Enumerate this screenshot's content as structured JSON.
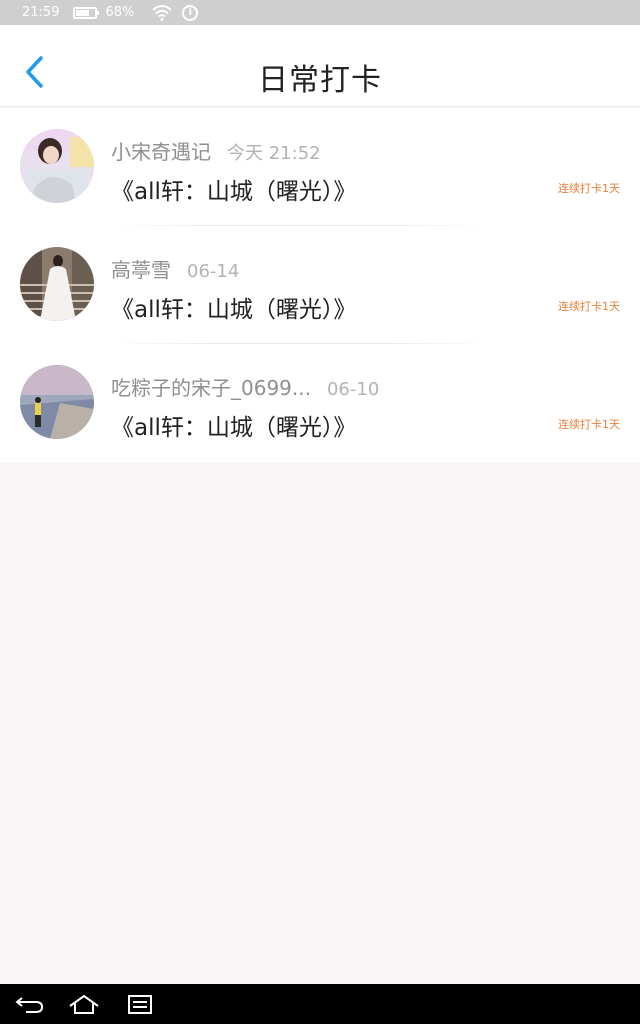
{
  "status_bar": {
    "time": "21:59",
    "battery_text": "68%",
    "battery_level": 0.68
  },
  "header": {
    "title": "日常打卡"
  },
  "items": [
    {
      "name": "小宋奇遇记",
      "date": "今天 21:52",
      "content": "《all轩：山城（曙光）》",
      "streak": "连续打卡1天"
    },
    {
      "name": "高葶雪",
      "date": "06-14",
      "content": "《all轩：山城（曙光）》",
      "streak": "连续打卡1天"
    },
    {
      "name": "吃粽子的宋子_0699...",
      "date": "06-10",
      "content": "《all轩：山城（曙光）》",
      "streak": "连续打卡1天"
    }
  ],
  "colors": {
    "accent": "#1e9be8",
    "streak": "#e8803a",
    "statusbar": "#cfcfcf",
    "background": "#f7f5f5"
  },
  "icons": {
    "back": "back-arrow-icon",
    "nav_back": "nav-back-icon",
    "nav_home": "nav-home-icon",
    "nav_recent": "nav-recent-icon"
  }
}
